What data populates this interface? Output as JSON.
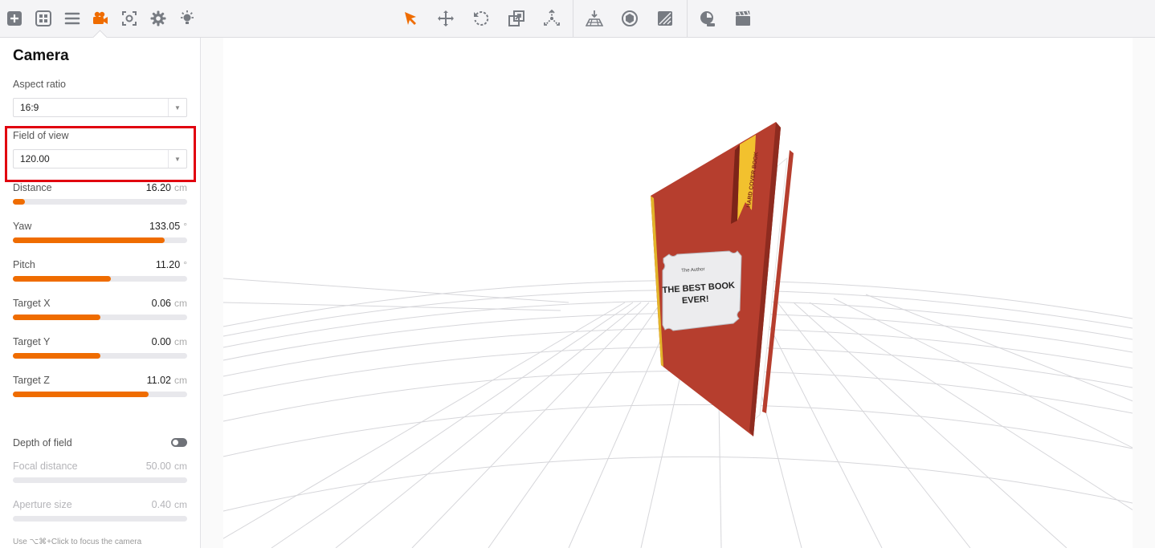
{
  "toolbar": {
    "left_icons": [
      "add-icon",
      "layout-icon",
      "menu-icon",
      "camera-icon",
      "focus-icon",
      "gear-icon",
      "light-icon"
    ],
    "center_icons": [
      "select-arrow-icon",
      "move-icon",
      "rotate-icon",
      "scale-icon",
      "pivot-icon"
    ],
    "right_icons": [
      "floor-icon",
      "material-icon",
      "texture-icon"
    ],
    "far_right_icons": [
      "timer-icon",
      "clapper-icon"
    ],
    "accent_color": "#ef6c00"
  },
  "panel": {
    "title": "Camera",
    "aspect_ratio": {
      "label": "Aspect ratio",
      "value": "16:9"
    },
    "field_of_view": {
      "label": "Field of view",
      "value": "120.00"
    },
    "sliders": [
      {
        "label": "Distance",
        "value": "16.20",
        "unit": "cm",
        "fraction": 0.07
      },
      {
        "label": "Yaw",
        "value": "133.05",
        "unit": "°",
        "fraction": 0.87
      },
      {
        "label": "Pitch",
        "value": "11.20",
        "unit": "°",
        "fraction": 0.56
      },
      {
        "label": "Target X",
        "value": "0.06",
        "unit": "cm",
        "fraction": 0.5
      },
      {
        "label": "Target Y",
        "value": "0.00",
        "unit": "cm",
        "fraction": 0.5
      },
      {
        "label": "Target Z",
        "value": "11.02",
        "unit": "cm",
        "fraction": 0.78
      }
    ],
    "depth_of_field": {
      "label": "Depth of field",
      "enabled": false
    },
    "focal_distance": {
      "label": "Focal distance",
      "value": "50.00",
      "unit": "cm"
    },
    "aperture_size": {
      "label": "Aperture size",
      "value": "0.40",
      "unit": "cm"
    },
    "hint": "Use ⌥⌘+Click to focus the camera"
  },
  "book": {
    "author": "The Author",
    "title_line1": "THE BEST BOOK",
    "title_line2": "EVER!",
    "ribbon": "HARD COVER BOOK",
    "cover_color": "#b63e2e",
    "ribbon_color": "#f2c12e"
  }
}
